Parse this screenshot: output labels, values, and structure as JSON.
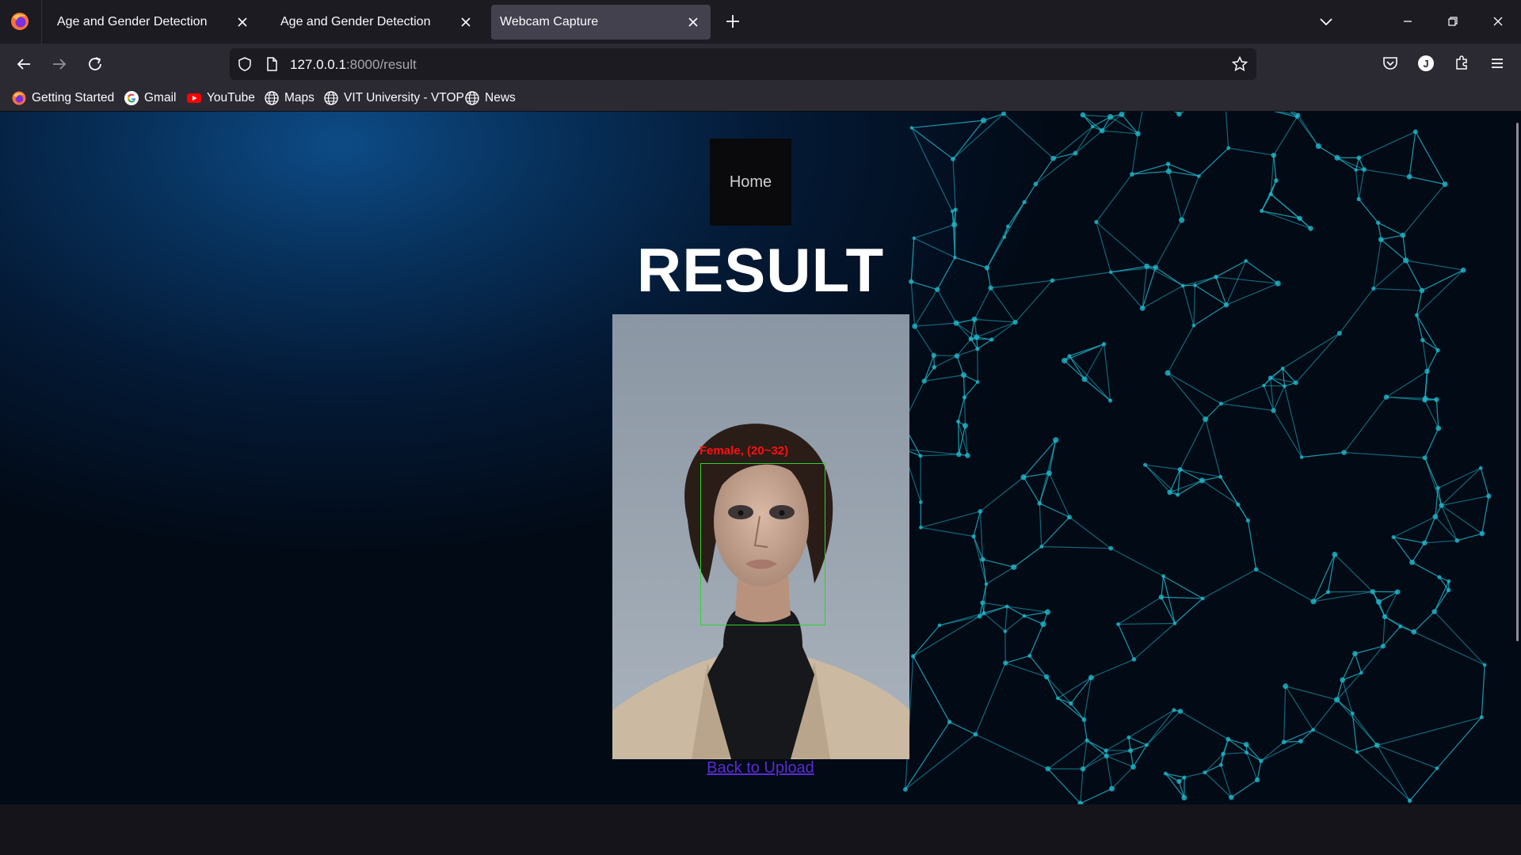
{
  "browser": {
    "tabs": [
      {
        "title": "Age and Gender Detection",
        "active": false
      },
      {
        "title": "Age and Gender Detection",
        "active": false
      },
      {
        "title": "Webcam Capture",
        "active": true
      }
    ],
    "url": {
      "host": "127.0.0.1",
      "rest": ":8000/result"
    },
    "profile_initial": "J",
    "bookmarks": [
      {
        "label": "Getting Started",
        "icon": "firefox-icon"
      },
      {
        "label": "Gmail",
        "icon": "google-icon"
      },
      {
        "label": "YouTube",
        "icon": "youtube-icon"
      },
      {
        "label": "Maps",
        "icon": "globe-icon"
      },
      {
        "label": "VIT University - VTOP",
        "icon": "globe-icon"
      },
      {
        "label": "News",
        "icon": "globe-icon"
      }
    ]
  },
  "page": {
    "home_label": "Home",
    "title": "RESULT",
    "detection": {
      "label": "Female, (20~32)",
      "box_color": "#2fd12f",
      "label_color": "#ff1010"
    },
    "back_link": "Back to Upload"
  },
  "colors": {
    "accent_bg": "#07305a",
    "link": "#5b2bd1",
    "mesh": "#1fb6c9"
  }
}
